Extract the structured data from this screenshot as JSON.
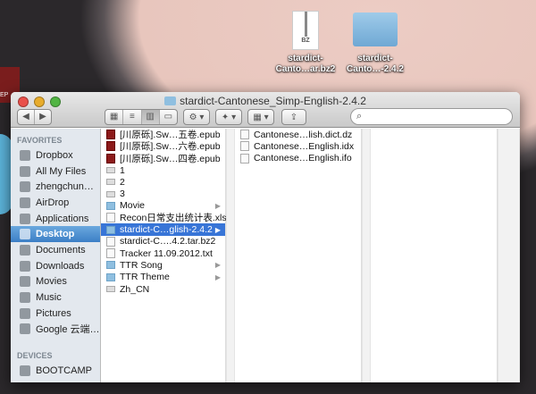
{
  "desktop": {
    "icons": [
      {
        "label1": "stardict-",
        "label2": "Canto…ar.bz2",
        "badge": "BZ"
      },
      {
        "label1": "stardict-",
        "label2": "Canto…-2.4.2"
      }
    ],
    "left_fragment": "EP"
  },
  "window": {
    "title": "stardict-Cantonese_Simp-English-2.4.2",
    "toolbar": {
      "back": "◀",
      "forward": "▶",
      "views": [
        "icon-view",
        "list-view",
        "column-view",
        "coverflow-view"
      ],
      "action": "⚙ ▾",
      "dropbox": "✦ ▾",
      "arrange": "▦ ▾",
      "share": "⇪",
      "search_placeholder": ""
    },
    "sidebar": {
      "favorites_header": "FAVORITES",
      "favorites": [
        "Dropbox",
        "All My Files",
        "zhengchun…",
        "AirDrop",
        "Applications",
        "Desktop",
        "Documents",
        "Downloads",
        "Movies",
        "Music",
        "Pictures",
        "Google 云端…"
      ],
      "selected": "Desktop",
      "devices_header": "DEVICES",
      "devices": [
        "BOOTCAMP"
      ]
    },
    "column1": [
      {
        "name": "[川原砾].Sw…五卷.epub",
        "type": "epub"
      },
      {
        "name": "[川原砾].Sw…六卷.epub",
        "type": "epub"
      },
      {
        "name": "[川原砾].Sw…四卷.epub",
        "type": "epub"
      },
      {
        "name": "1",
        "type": "disk"
      },
      {
        "name": "2",
        "type": "disk"
      },
      {
        "name": "3",
        "type": "disk"
      },
      {
        "name": "Movie",
        "type": "folder",
        "arrow": "▶"
      },
      {
        "name": "Recon日常支出统计表.xls",
        "type": "file"
      },
      {
        "name": "stardict-C…glish-2.4.2",
        "type": "folder",
        "arrow": "▶",
        "selected": true
      },
      {
        "name": "stardict-C….4.2.tar.bz2",
        "type": "file"
      },
      {
        "name": "Tracker 11.09.2012.txt",
        "type": "file"
      },
      {
        "name": "TTR Song",
        "type": "folder",
        "arrow": "▶"
      },
      {
        "name": "TTR Theme",
        "type": "folder",
        "arrow": "▶"
      },
      {
        "name": "Zh_CN",
        "type": "disk"
      }
    ],
    "column2": [
      {
        "name": "Cantonese…lish.dict.dz"
      },
      {
        "name": "Cantonese…English.idx"
      },
      {
        "name": "Cantonese…English.ifo"
      }
    ]
  }
}
